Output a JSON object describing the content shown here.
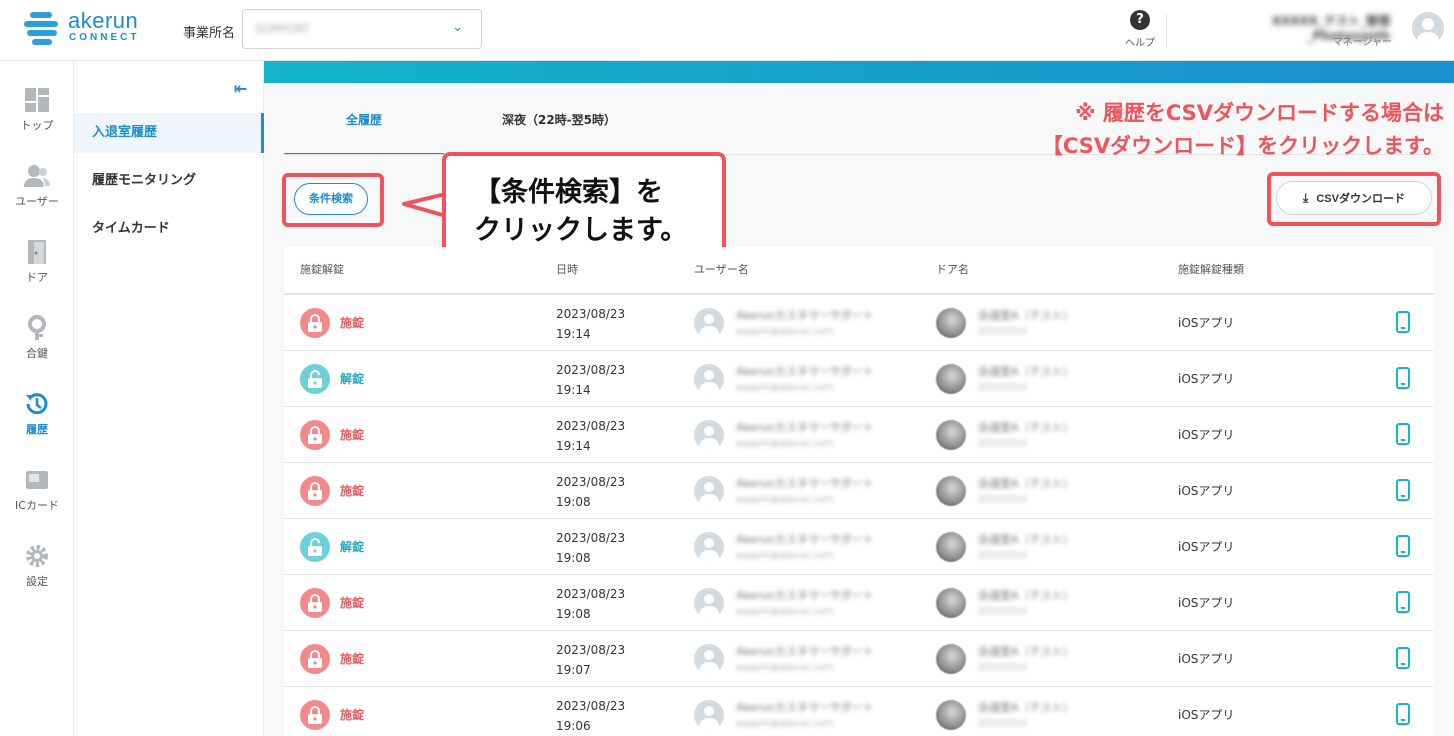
{
  "header": {
    "logo_word": "akerun",
    "logo_sub": "CONNECT",
    "office_label": "事業所名",
    "office_value": "SUPPORT",
    "help_label": "ヘルプ",
    "user_name": "XXXXX_テスト_管理_Photosynth",
    "user_role": "マネージャー"
  },
  "rail": [
    {
      "name": "top",
      "label": "トップ",
      "icon": "dashboard-icon"
    },
    {
      "name": "users",
      "label": "ユーザー",
      "icon": "users-icon"
    },
    {
      "name": "doors",
      "label": "ドア",
      "icon": "door-icon"
    },
    {
      "name": "keys",
      "label": "合鍵",
      "icon": "key-icon"
    },
    {
      "name": "history",
      "label": "履歴",
      "icon": "history-icon",
      "active": true
    },
    {
      "name": "iccard",
      "label": "ICカード",
      "icon": "card-icon"
    },
    {
      "name": "settings",
      "label": "設定",
      "icon": "gear-icon"
    }
  ],
  "subnav": {
    "items": [
      "入退室履歴",
      "履歴モニタリング",
      "タイムカード"
    ],
    "active": "入退室履歴"
  },
  "tabs": [
    "全履歴",
    "深夜（22時-翌5時）"
  ],
  "filter_button": "条件検索",
  "csv_button": "CSVダウンロード",
  "annotations": {
    "callout_line1": "【条件検索】を",
    "callout_line2": "クリックします。",
    "note_line1": "※ 履歴をCSVダウンロードする場合は",
    "note_line2": "【CSVダウンロード】をクリックします。"
  },
  "table": {
    "headers": [
      "施錠解錠",
      "日時",
      "ユーザー名",
      "ドア名",
      "施錠解錠種類"
    ],
    "rows": [
      {
        "status": "施錠",
        "type": "lock",
        "date": "2023/08/23",
        "time": "19:14",
        "user": "Akerunカスタマーサポート",
        "email": "support@akerun.com",
        "door": "会議室A（テスト）",
        "door_sub": "XXXXXXXX",
        "kind": "iOSアプリ"
      },
      {
        "status": "解錠",
        "type": "unlock",
        "date": "2023/08/23",
        "time": "19:14",
        "user": "Akerunカスタマーサポート",
        "email": "support@akerun.com",
        "door": "会議室A（テスト）",
        "door_sub": "XXXXXXXX",
        "kind": "iOSアプリ"
      },
      {
        "status": "施錠",
        "type": "lock",
        "date": "2023/08/23",
        "time": "19:14",
        "user": "Akerunカスタマーサポート",
        "email": "support@akerun.com",
        "door": "会議室A（テスト）",
        "door_sub": "XXXXXXXX",
        "kind": "iOSアプリ"
      },
      {
        "status": "施錠",
        "type": "lock",
        "date": "2023/08/23",
        "time": "19:08",
        "user": "Akerunカスタマーサポート",
        "email": "support@akerun.com",
        "door": "会議室A（テスト）",
        "door_sub": "XXXXXXXX",
        "kind": "iOSアプリ"
      },
      {
        "status": "解錠",
        "type": "unlock",
        "date": "2023/08/23",
        "time": "19:08",
        "user": "Akerunカスタマーサポート",
        "email": "support@akerun.com",
        "door": "会議室A（テスト）",
        "door_sub": "XXXXXXXX",
        "kind": "iOSアプリ"
      },
      {
        "status": "施錠",
        "type": "lock",
        "date": "2023/08/23",
        "time": "19:08",
        "user": "Akerunカスタマーサポート",
        "email": "support@akerun.com",
        "door": "会議室A（テスト）",
        "door_sub": "XXXXXXXX",
        "kind": "iOSアプリ"
      },
      {
        "status": "施錠",
        "type": "lock",
        "date": "2023/08/23",
        "time": "19:07",
        "user": "Akerunカスタマーサポート",
        "email": "support@akerun.com",
        "door": "会議室A（テスト）",
        "door_sub": "XXXXXXXX",
        "kind": "iOSアプリ"
      },
      {
        "status": "施錠",
        "type": "lock",
        "date": "2023/08/23",
        "time": "19:06",
        "user": "Akerunカスタマーサポート",
        "email": "support@akerun.com",
        "door": "会議室A（テスト）",
        "door_sub": "XXXXXXXX",
        "kind": "iOSアプリ"
      }
    ]
  },
  "colors": {
    "accent": "#1f8ccc",
    "highlight": "#f0535a",
    "lock": "#f18a8a",
    "unlock": "#6fd0dc"
  }
}
